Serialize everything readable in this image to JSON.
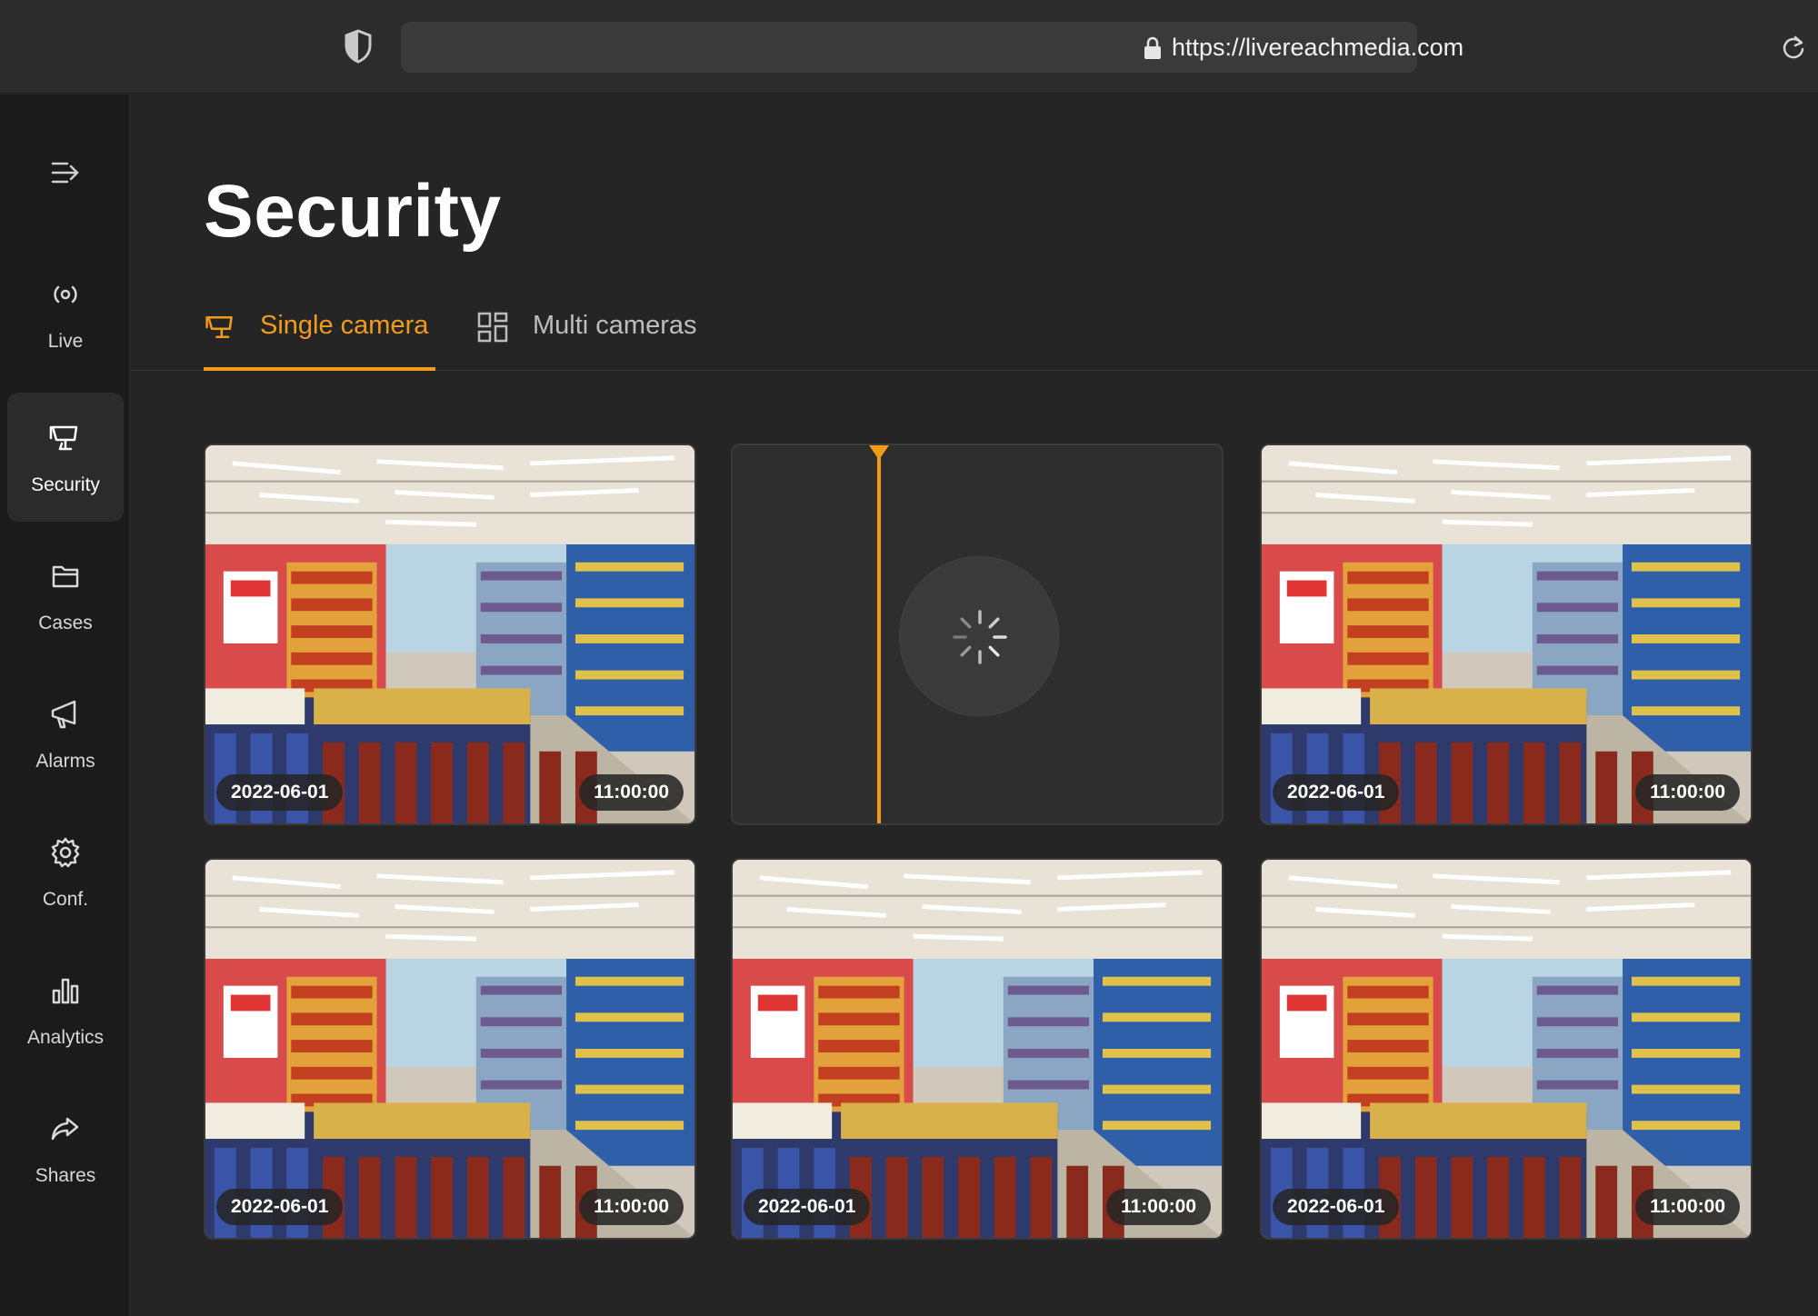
{
  "browser": {
    "url": "https://livereachmedia.com"
  },
  "sidebar": {
    "items": [
      {
        "label": "Live",
        "icon": "broadcast-icon"
      },
      {
        "label": "Security",
        "icon": "security-camera-icon",
        "active": true
      },
      {
        "label": "Cases",
        "icon": "folder-icon"
      },
      {
        "label": "Alarms",
        "icon": "megaphone-icon"
      },
      {
        "label": "Conf.",
        "icon": "gear-icon"
      },
      {
        "label": "Analytics",
        "icon": "bar-chart-icon"
      },
      {
        "label": "Shares",
        "icon": "share-arrow-icon"
      }
    ]
  },
  "main": {
    "title": "Security",
    "tabs": [
      {
        "label": "Single camera",
        "icon": "security-camera-icon",
        "active": true
      },
      {
        "label": "Multi cameras",
        "icon": "grid-icon"
      }
    ],
    "cameras": [
      {
        "date": "2022-06-01",
        "time": "11:00:00",
        "state": "playing"
      },
      {
        "state": "loading"
      },
      {
        "date": "2022-06-01",
        "time": "11:00:00",
        "state": "playing"
      },
      {
        "date": "2022-06-01",
        "time": "11:00:00",
        "state": "playing"
      },
      {
        "date": "2022-06-01",
        "time": "11:00:00",
        "state": "playing"
      },
      {
        "date": "2022-06-01",
        "time": "11:00:00",
        "state": "playing"
      }
    ]
  },
  "colors": {
    "accent": "#f29a1a",
    "background": "#252525",
    "sidebar": "#1b1b1b"
  }
}
